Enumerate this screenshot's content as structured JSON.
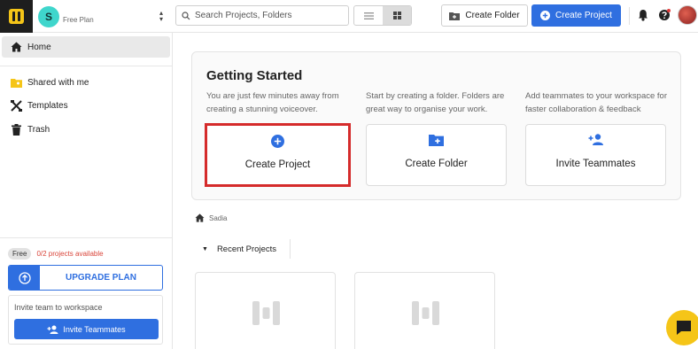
{
  "workspace": {
    "initial": "S",
    "plan": "Free Plan"
  },
  "search": {
    "placeholder": "Search Projects, Folders"
  },
  "header": {
    "create_folder_label": "Create Folder",
    "create_project_label": "Create Project"
  },
  "sidebar": {
    "items": [
      {
        "label": "Home",
        "icon": "home-icon",
        "active": true
      },
      {
        "label": "Shared with me",
        "icon": "shared-folder-icon"
      },
      {
        "label": "Templates",
        "icon": "templates-icon"
      },
      {
        "label": "Trash",
        "icon": "trash-icon"
      }
    ],
    "plan_badge": "Free",
    "usage_text": "0/2 projects available",
    "upgrade_label": "UPGRADE PLAN",
    "invite_title": "Invite team to workspace",
    "invite_button": "Invite Teammates"
  },
  "getting_started": {
    "title": "Getting Started",
    "columns": [
      {
        "desc": "You are just few minutes away from creating a stunning voiceover.",
        "card_label": "Create Project",
        "icon": "plus-circle-icon"
      },
      {
        "desc": "Start by creating a folder. Folders are great way to organise your work.",
        "card_label": "Create Folder",
        "icon": "folder-plus-icon"
      },
      {
        "desc": "Add teammates to your workspace for faster collaboration & feedback",
        "card_label": "Invite Teammates",
        "icon": "add-person-icon"
      }
    ]
  },
  "breadcrumb": {
    "label": "Sadia"
  },
  "recent": {
    "heading": "Recent Projects"
  },
  "colors": {
    "accent": "#2f6fe0",
    "brand_yellow": "#f5c518",
    "highlight": "#d52b2b",
    "danger_text": "#d9453a"
  }
}
